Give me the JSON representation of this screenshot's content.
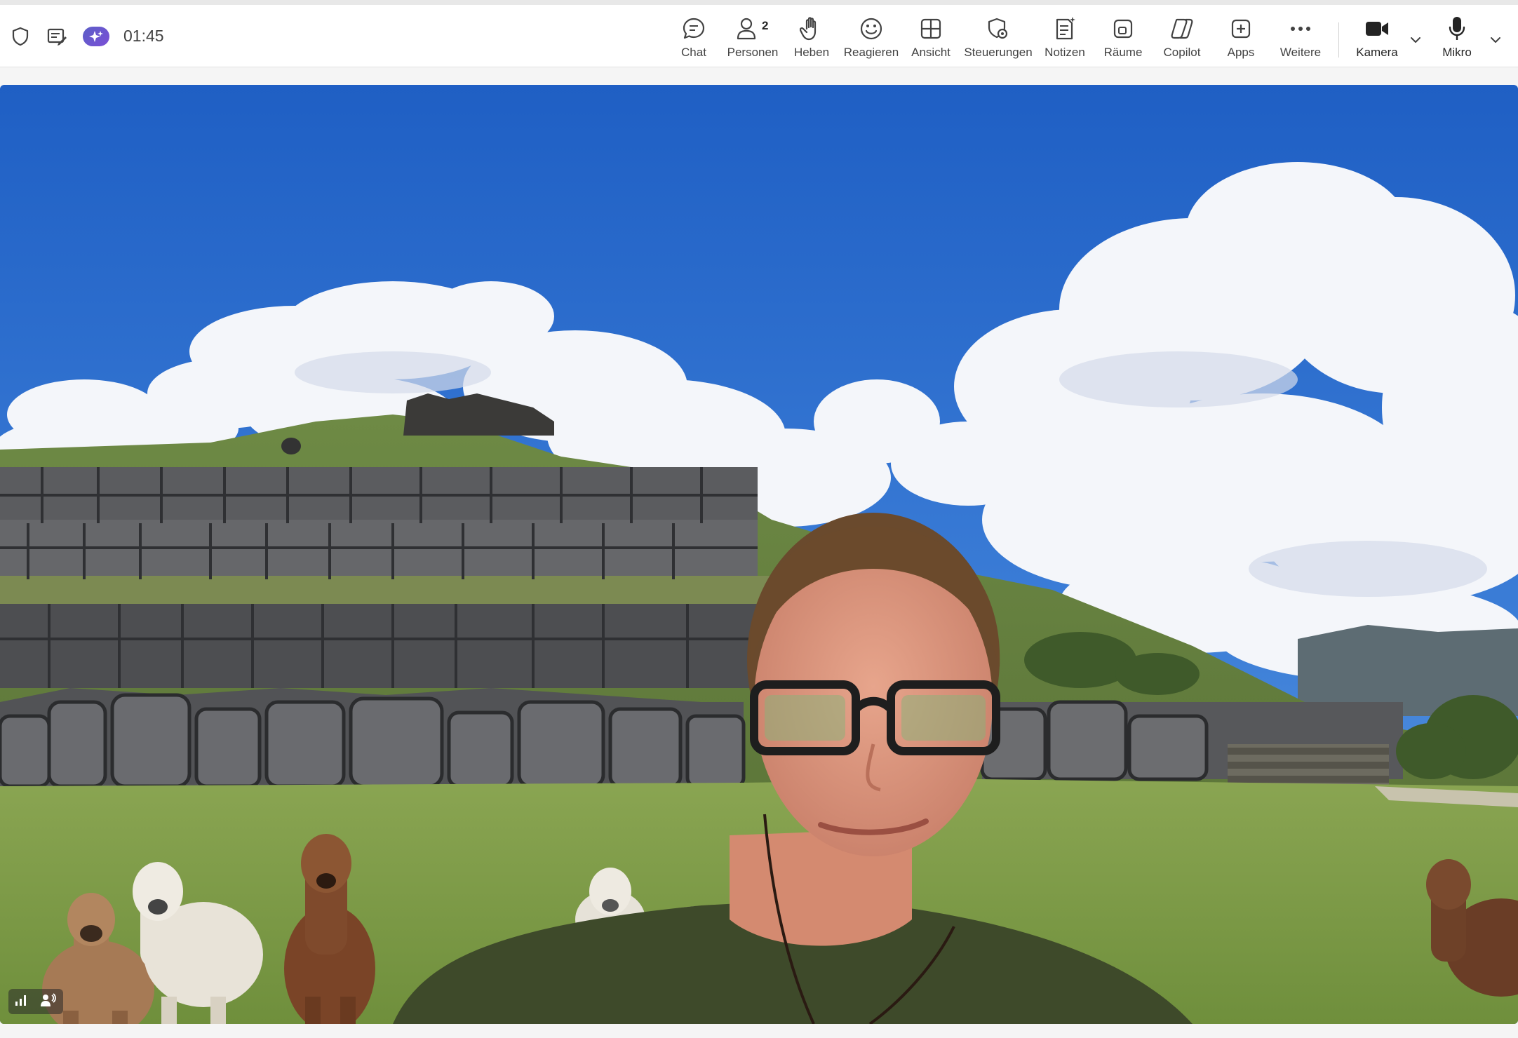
{
  "header": {
    "timer": "01:45",
    "left_icons": [
      "shield-icon",
      "notes-edit-icon",
      "copilot-sparkle-icon"
    ]
  },
  "toolbar": {
    "people_count": "2",
    "buttons": [
      {
        "id": "chat",
        "label": "Chat",
        "icon": "chat-bubble-icon"
      },
      {
        "id": "people",
        "label": "Personen",
        "icon": "people-icon"
      },
      {
        "id": "raise",
        "label": "Heben",
        "icon": "raise-hand-icon"
      },
      {
        "id": "react",
        "label": "Reagieren",
        "icon": "smiley-icon"
      },
      {
        "id": "view",
        "label": "Ansicht",
        "icon": "grid-view-icon"
      },
      {
        "id": "controls",
        "label": "Steuerungen",
        "icon": "shield-gear-icon"
      },
      {
        "id": "notes",
        "label": "Notizen",
        "icon": "notes-icon"
      },
      {
        "id": "rooms",
        "label": "Räume",
        "icon": "breakout-rooms-icon"
      },
      {
        "id": "copilot",
        "label": "Copilot",
        "icon": "copilot-icon"
      },
      {
        "id": "apps",
        "label": "Apps",
        "icon": "add-app-icon"
      },
      {
        "id": "more",
        "label": "Weitere",
        "icon": "more-dots-icon"
      },
      {
        "id": "camera",
        "label": "Kamera",
        "icon": "video-camera-icon"
      },
      {
        "id": "mic",
        "label": "Mikro",
        "icon": "microphone-icon"
      }
    ]
  },
  "video": {
    "scene": "Participant in front of Inca stone ruins background with alpacas",
    "indicator_icons": [
      "signal-bars-icon",
      "speaking-person-icon"
    ]
  },
  "colors": {
    "copilot_gradient_start": "#5b5fc7",
    "copilot_gradient_end": "#7b4fd6",
    "sky": "#2f6fd0",
    "grass": "#7f9a45",
    "stone": "#55565a",
    "shirt": "#3f4a2b"
  }
}
